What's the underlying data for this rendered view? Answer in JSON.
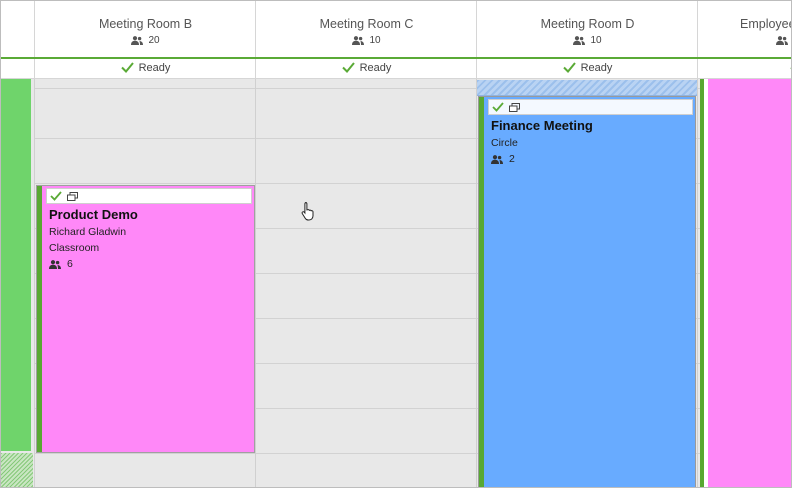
{
  "colors": {
    "ready": "#5aaa36",
    "pink": "#ff88f8",
    "blue": "#68abff",
    "green": "#6fd46b"
  },
  "resources": [
    {
      "name": "Meeting Room B",
      "capacity": "20",
      "status": "Ready"
    },
    {
      "name": "Meeting Room C",
      "capacity": "10",
      "status": "Ready"
    },
    {
      "name": "Meeting Room D",
      "capacity": "10",
      "status": "Ready"
    },
    {
      "name": "Employee",
      "capacity": "",
      "status": ""
    }
  ],
  "events": [
    {
      "title": "Product Demo",
      "person": "Richard Gladwin",
      "layout": "Classroom",
      "attendees": "6"
    },
    {
      "title": "Finance Meeting",
      "layout": "Circle",
      "attendees": "2"
    }
  ]
}
